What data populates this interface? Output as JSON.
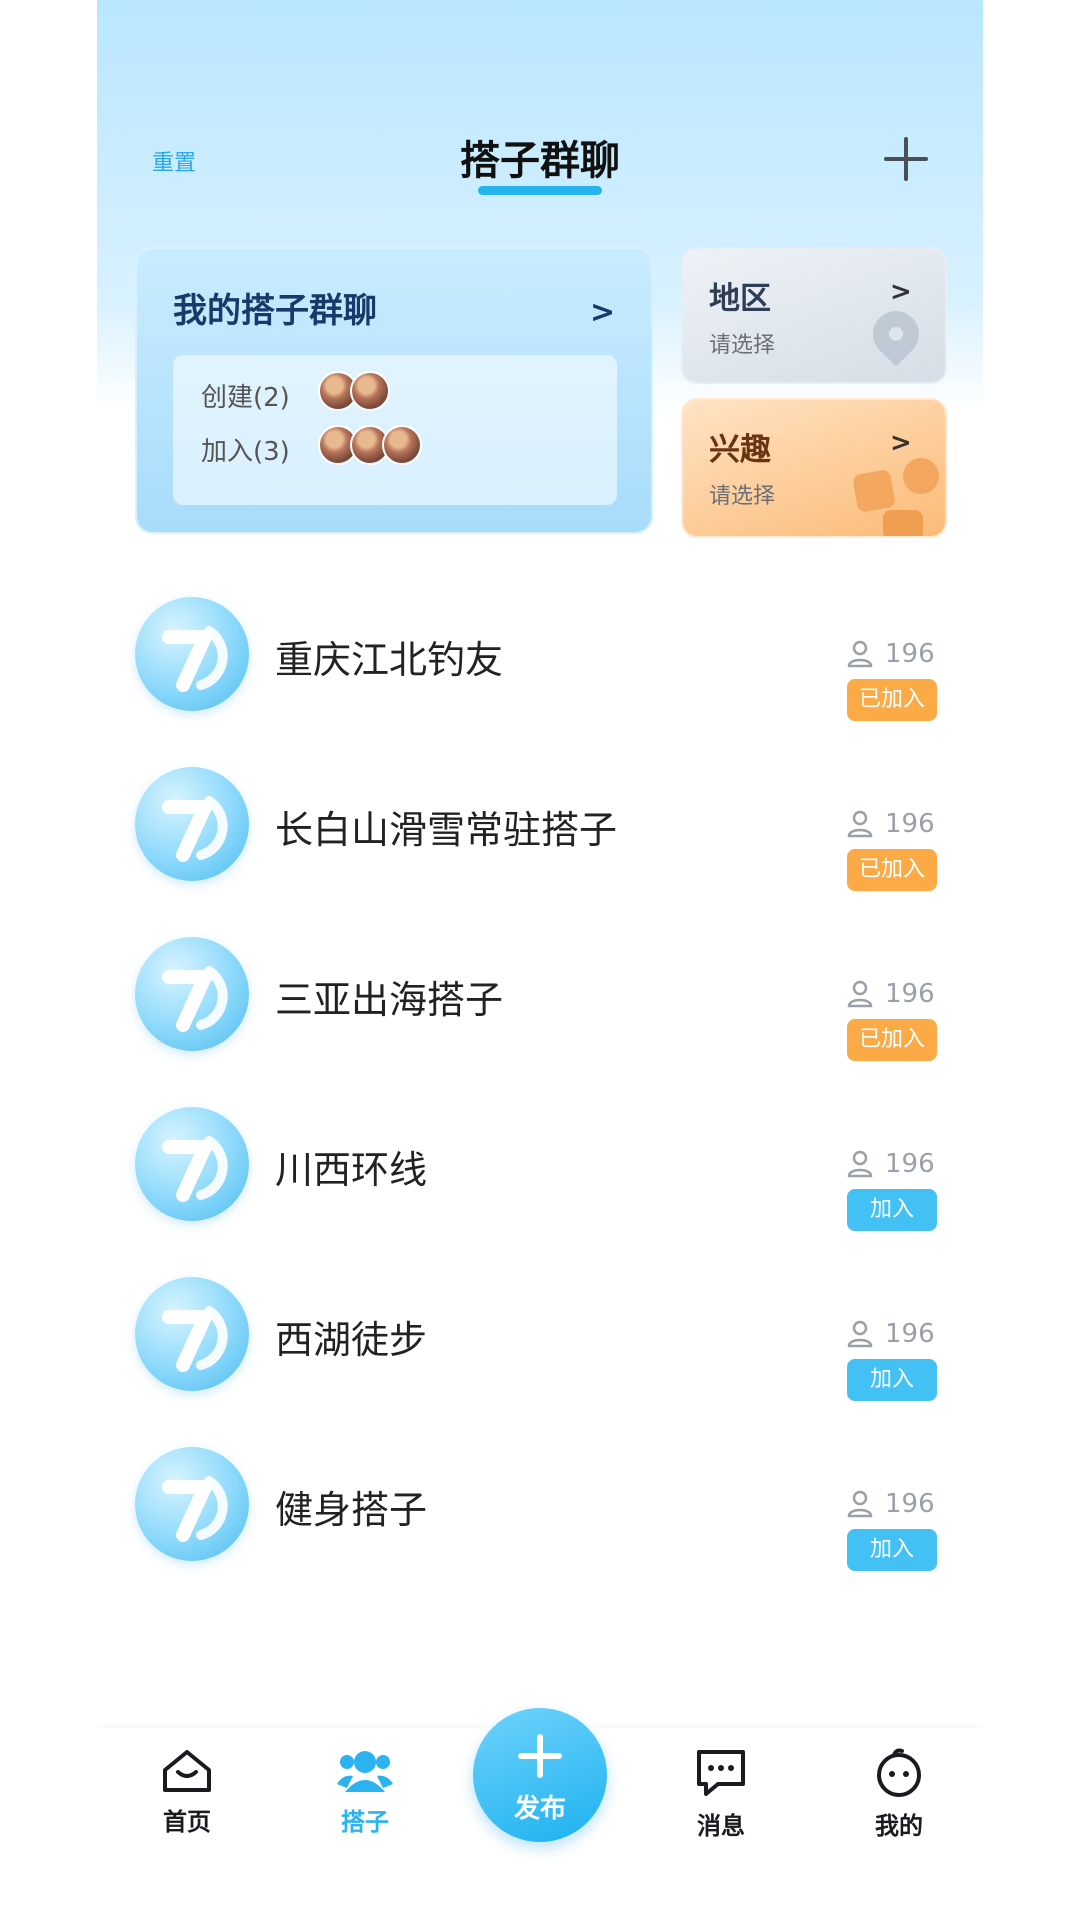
{
  "header": {
    "reset_label": "重置",
    "title": "搭子群聊"
  },
  "my_groups": {
    "title": "我的搭子群聊",
    "created_label": "创建(2)",
    "created_count": 2,
    "joined_label": "加入(3)",
    "joined_count": 3
  },
  "filters": {
    "region": {
      "title": "地区",
      "subtitle": "请选择"
    },
    "interest": {
      "title": "兴趣",
      "subtitle": "请选择"
    }
  },
  "groups": [
    {
      "name": "重庆江北钓友",
      "members": "196",
      "action": "已加入",
      "joined": true
    },
    {
      "name": "长白山滑雪常驻搭子",
      "members": "196",
      "action": "已加入",
      "joined": true
    },
    {
      "name": "三亚出海搭子",
      "members": "196",
      "action": "已加入",
      "joined": true
    },
    {
      "name": "川西环线",
      "members": "196",
      "action": "加入",
      "joined": false
    },
    {
      "name": "西湖徒步",
      "members": "196",
      "action": "加入",
      "joined": false
    },
    {
      "name": "健身搭子",
      "members": "196",
      "action": "加入",
      "joined": false
    }
  ],
  "tabbar": {
    "home": "首页",
    "partners": "搭子",
    "publish": "发布",
    "messages": "消息",
    "mine": "我的",
    "active": "partners"
  },
  "colors": {
    "accent": "#25b4f0",
    "joined": "#fbaa45",
    "join": "#43c1f4"
  }
}
